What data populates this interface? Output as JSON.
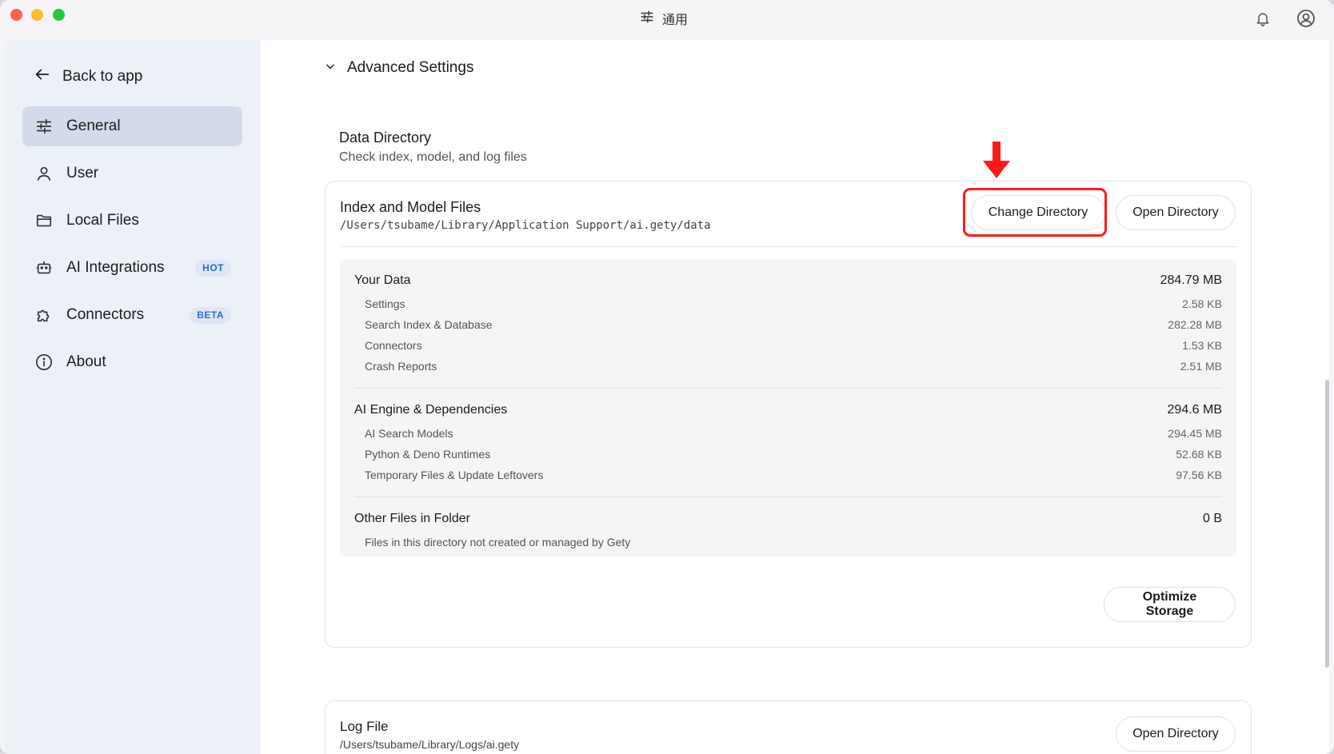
{
  "window": {
    "title": "通用",
    "title_icon": "sliders-icon",
    "right_icons": [
      "bell-icon",
      "account-icon"
    ]
  },
  "sidebar": {
    "back_label": "Back to app",
    "items": [
      {
        "label": "General",
        "icon": "sliders-icon",
        "active": true
      },
      {
        "label": "User",
        "icon": "user-icon"
      },
      {
        "label": "Local Files",
        "icon": "folder-icon"
      },
      {
        "label": "AI Integrations",
        "icon": "robot-icon",
        "badge": "HOT"
      },
      {
        "label": "Connectors",
        "icon": "puzzle-icon",
        "badge": "BETA"
      },
      {
        "label": "About",
        "icon": "info-icon"
      }
    ]
  },
  "main": {
    "section_title": "Advanced Settings",
    "data_directory": {
      "title": "Data Directory",
      "subtitle": "Check index, model, and log files"
    },
    "index_card": {
      "title": "Index and Model Files",
      "path": "/Users/tsubame/Library/Application Support/ai.gety/data",
      "change_button": "Change Directory",
      "open_button": "Open Directory",
      "groups": [
        {
          "label": "Your Data",
          "size": "284.79 MB",
          "items": [
            {
              "label": "Settings",
              "size": "2.58 KB"
            },
            {
              "label": "Search Index & Database",
              "size": "282.28 MB"
            },
            {
              "label": "Connectors",
              "size": "1.53 KB"
            },
            {
              "label": "Crash Reports",
              "size": "2.51 MB"
            }
          ]
        },
        {
          "label": "AI Engine & Dependencies",
          "size": "294.6 MB",
          "items": [
            {
              "label": "AI Search Models",
              "size": "294.45 MB"
            },
            {
              "label": "Python & Deno Runtimes",
              "size": "52.68 KB"
            },
            {
              "label": "Temporary Files & Update Leftovers",
              "size": "97.56 KB"
            }
          ]
        },
        {
          "label": "Other Files in Folder",
          "size": "0 B",
          "note": "Files in this directory not created or managed by Gety"
        }
      ],
      "optimize_button": "Optimize Storage"
    },
    "log_card": {
      "title": "Log File",
      "path": "/Users/tsubame/Library/Logs/ai.gety",
      "open_button": "Open Directory"
    }
  },
  "annotation": {
    "color": "#ff1a1a"
  }
}
